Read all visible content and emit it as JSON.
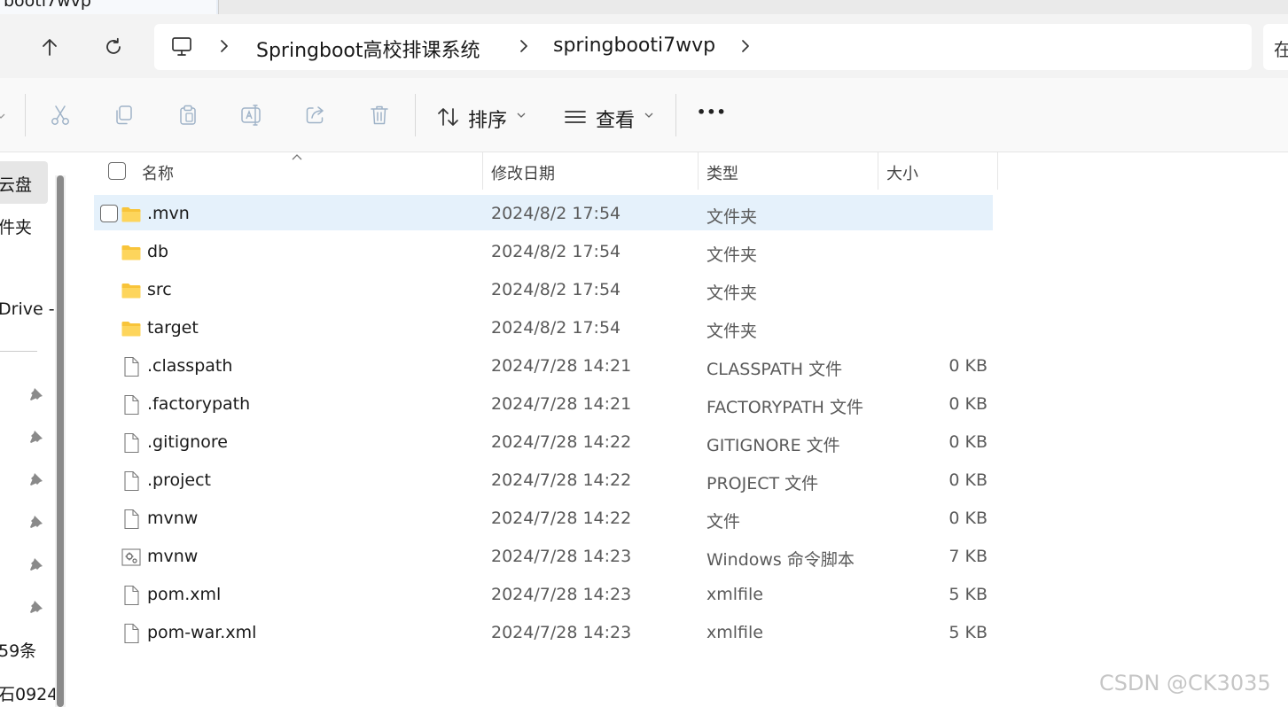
{
  "window": {
    "tab_title": "booti7wvp"
  },
  "address": {
    "crumbs": [
      "Springboot高校排课系统",
      "springbooti7wvp"
    ],
    "search_glyph": "在"
  },
  "toolbar": {
    "sort_label": "排序",
    "view_label": "查看",
    "more_label": "•••"
  },
  "sidebar": {
    "items": [
      {
        "label": "云盘",
        "selected": true
      },
      {
        "label": "件夹"
      },
      {
        "label": "Drive - I"
      }
    ],
    "pinned_count": 6,
    "bottom_items": [
      "59条",
      "石0924"
    ]
  },
  "list": {
    "columns": {
      "name": "名称",
      "date": "修改日期",
      "type": "类型",
      "size": "大小"
    },
    "rows": [
      {
        "icon": "folder",
        "name": ".mvn",
        "date": "2024/8/2 17:54",
        "type": "文件夹",
        "size": ""
      },
      {
        "icon": "folder",
        "name": "db",
        "date": "2024/8/2 17:54",
        "type": "文件夹",
        "size": ""
      },
      {
        "icon": "folder",
        "name": "src",
        "date": "2024/8/2 17:54",
        "type": "文件夹",
        "size": ""
      },
      {
        "icon": "folder",
        "name": "target",
        "date": "2024/8/2 17:54",
        "type": "文件夹",
        "size": ""
      },
      {
        "icon": "file",
        "name": ".classpath",
        "date": "2024/7/28 14:21",
        "type": "CLASSPATH 文件",
        "size": "0 KB"
      },
      {
        "icon": "file",
        "name": ".factorypath",
        "date": "2024/7/28 14:21",
        "type": "FACTORYPATH 文件",
        "size": "0 KB"
      },
      {
        "icon": "file",
        "name": ".gitignore",
        "date": "2024/7/28 14:22",
        "type": "GITIGNORE 文件",
        "size": "0 KB"
      },
      {
        "icon": "file",
        "name": ".project",
        "date": "2024/7/28 14:22",
        "type": "PROJECT 文件",
        "size": "0 KB"
      },
      {
        "icon": "file",
        "name": "mvnw",
        "date": "2024/7/28 14:22",
        "type": "文件",
        "size": "0 KB"
      },
      {
        "icon": "script",
        "name": "mvnw",
        "date": "2024/7/28 14:23",
        "type": "Windows 命令脚本",
        "size": "7 KB"
      },
      {
        "icon": "file",
        "name": "pom.xml",
        "date": "2024/7/28 14:23",
        "type": "xmlfile",
        "size": "5 KB"
      },
      {
        "icon": "file",
        "name": "pom-war.xml",
        "date": "2024/7/28 14:23",
        "type": "xmlfile",
        "size": "5 KB"
      }
    ]
  },
  "watermark": "CSDN @CK3035",
  "colors": {
    "selection": "#e5f1fb",
    "folder": "#f8c43a",
    "chrome": "#f3f3f3"
  }
}
